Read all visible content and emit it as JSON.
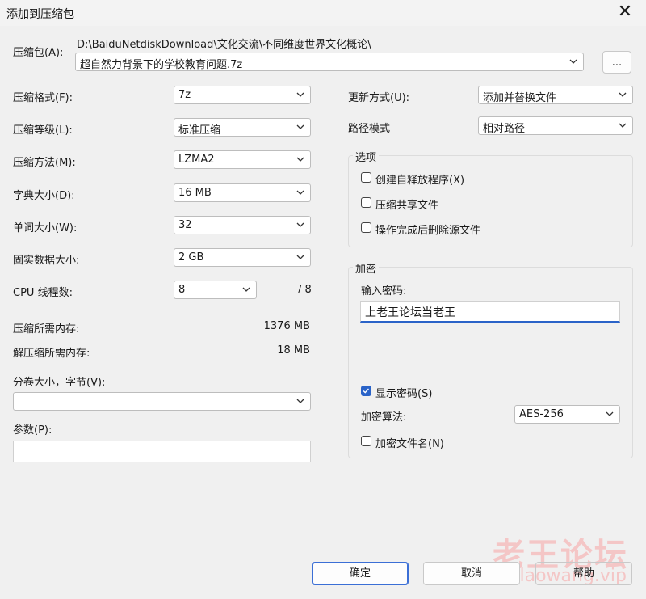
{
  "window": {
    "title": "添加到压缩包"
  },
  "archive": {
    "label": "压缩包(A):",
    "path": "D:\\BaiduNetdiskDownload\\文化交流\\不同维度世界文化概论\\",
    "filename": "超自然力背景下的学校教育问题.7z",
    "browse_label": "..."
  },
  "left": {
    "format": {
      "label": "压缩格式(F):",
      "value": "7z"
    },
    "level": {
      "label": "压缩等级(L):",
      "value": "标准压缩"
    },
    "method": {
      "label": "压缩方法(M):",
      "value": "LZMA2"
    },
    "dict": {
      "label": "字典大小(D):",
      "value": "16 MB"
    },
    "word": {
      "label": "单词大小(W):",
      "value": "32"
    },
    "solid": {
      "label": "固实数据大小:",
      "value": "2 GB"
    },
    "threads": {
      "label": "CPU 线程数:",
      "value": "8",
      "max": "/ 8"
    },
    "mem_compress": {
      "label": "压缩所需内存:",
      "value": "1376 MB"
    },
    "mem_decompress": {
      "label": "解压缩所需内存:",
      "value": "18 MB"
    },
    "volume": {
      "label": "分卷大小，字节(V):",
      "value": ""
    },
    "params": {
      "label": "参数(P):",
      "value": ""
    }
  },
  "right": {
    "update": {
      "label": "更新方式(U):",
      "value": "添加并替换文件"
    },
    "pathmode": {
      "label": "路径模式",
      "value": "相对路径"
    },
    "options": {
      "title": "选项",
      "sfx": "创建自释放程序(X)",
      "shared": "压缩共享文件",
      "delete": "操作完成后删除源文件"
    },
    "encryption": {
      "title": "加密",
      "pw_label": "输入密码:",
      "pw_value": "上老王论坛当老王",
      "show_pw": "显示密码(S)",
      "algo_label": "加密算法:",
      "algo_value": "AES-256",
      "encrypt_names": "加密文件名(N)"
    }
  },
  "buttons": {
    "ok": "确定",
    "cancel": "取消",
    "help": "帮助"
  },
  "watermark": {
    "main": "老王论坛",
    "sub": "laowang.vip"
  }
}
